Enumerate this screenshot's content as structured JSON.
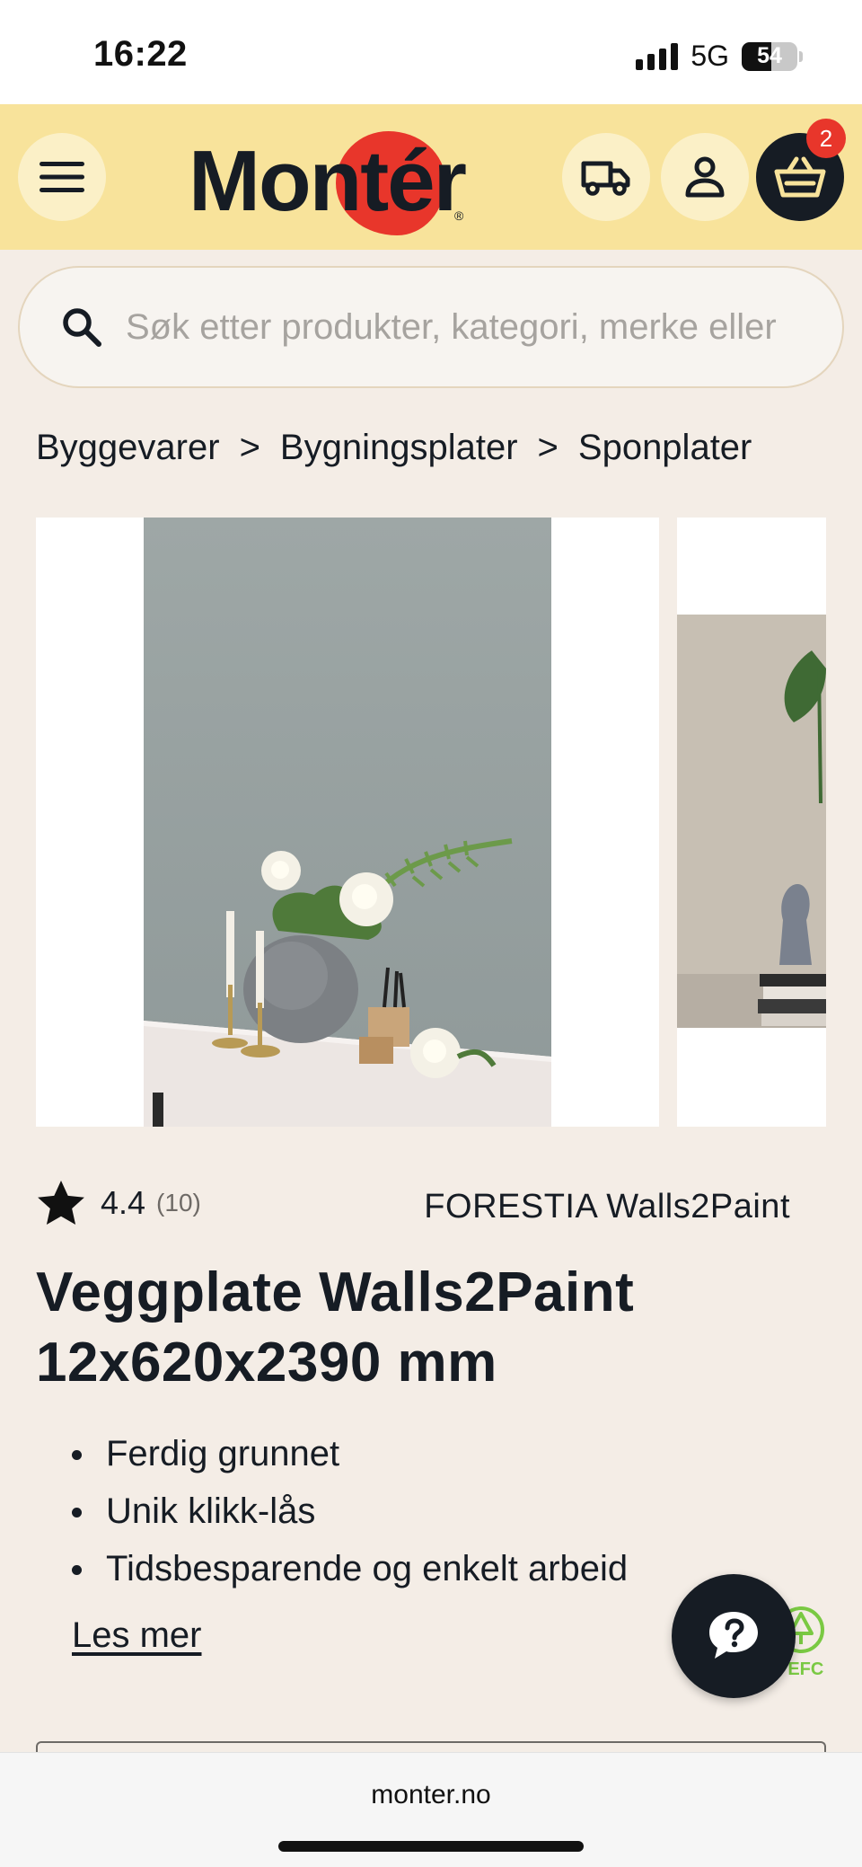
{
  "status_bar": {
    "time": "16:22",
    "network": "5G",
    "battery": "54",
    "battery_level": 0.54
  },
  "header": {
    "logo_text": "Montér",
    "logo_registered": "®",
    "cart_count": "2",
    "icons": {
      "menu": "hamburger-icon",
      "delivery": "truck-icon",
      "account": "user-icon",
      "cart": "basket-icon"
    }
  },
  "search": {
    "placeholder": "Søk etter produkter, kategori, merke eller",
    "icon": "search-icon"
  },
  "breadcrumb": [
    {
      "label": "Byggevarer"
    },
    {
      "label": "Bygningsplater"
    },
    {
      "label": "Sponplater"
    }
  ],
  "breadcrumb_separator": ">",
  "product": {
    "rating": "4.4",
    "review_count": "(10)",
    "brand": "FORESTIA Walls2Paint",
    "title": "Veggplate Walls2Paint 12x620x2390 mm",
    "features": [
      "Ferdig grunnet",
      "Unik klikk-lås",
      "Tidsbesparende og enkelt arbeid"
    ],
    "read_more": "Les mer",
    "certification": "PEFC"
  },
  "help": {
    "icon": "question-icon"
  },
  "browser": {
    "url": "monter.no"
  },
  "colors": {
    "header_bg": "#f8e39b",
    "brand_red": "#e8362b",
    "dark": "#161c24",
    "page_bg": "#f4ede6",
    "pefc_green": "#7ac943"
  }
}
